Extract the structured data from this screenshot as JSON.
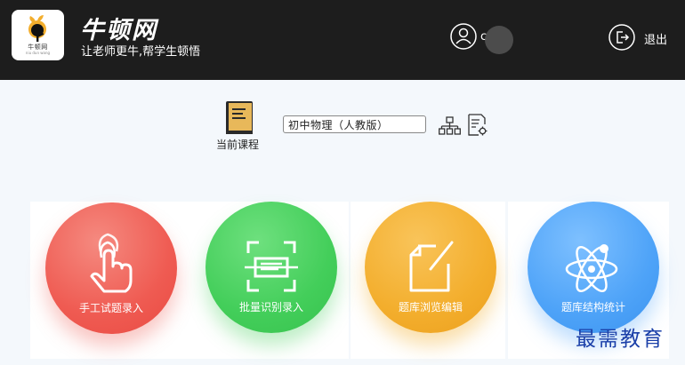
{
  "header": {
    "logo_text": "牛顿网",
    "logo_subtext": "niu dun wang",
    "title": "牛顿网",
    "slogan": "让老师更牛,帮学生顿悟",
    "user_name": "c",
    "logout_label": "退出"
  },
  "course": {
    "caption": "当前课程",
    "selected": "初中物理（人教版）"
  },
  "actions": [
    {
      "label": "手工试题录入",
      "color": "#ef5b52"
    },
    {
      "label": "批量识别录入",
      "color": "#43ce5a"
    },
    {
      "label": "题库浏览编辑",
      "color": "#f3ae2d"
    },
    {
      "label": "题库结构统计",
      "color": "#4ea3f8"
    }
  ],
  "watermark": "最需教育"
}
